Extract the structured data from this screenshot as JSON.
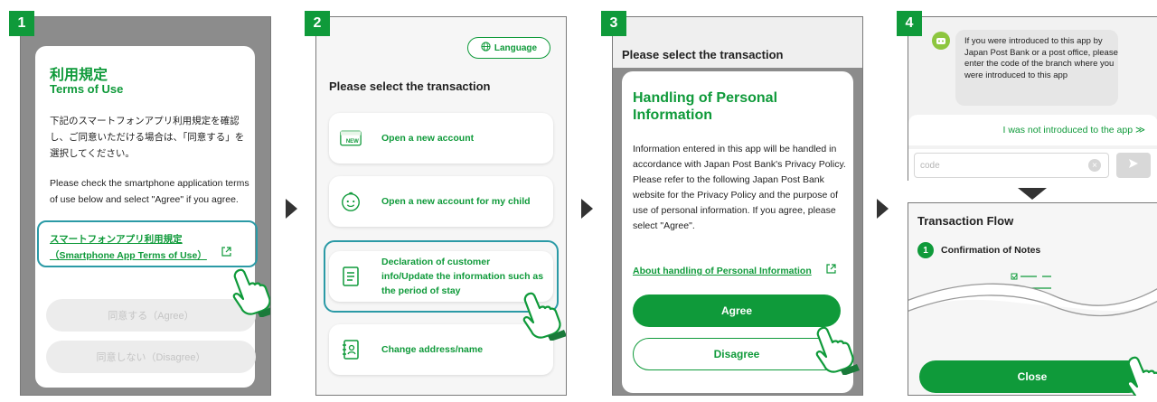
{
  "steps": [
    "1",
    "2",
    "3",
    "4"
  ],
  "panel1": {
    "title_jp": "利用規定",
    "title_en": "Terms of Use",
    "body_jp": "下記のスマートフォンアプリ利用規定を確認し、ご同意いただける場合は、「同意する」を選択してください。",
    "body_en": "Please check the smartphone application terms of use below and select \"Agree\" if you agree.",
    "link_jp": "スマートフォンアプリ利用規定",
    "link_en": "（Smartphone App Terms of Use）",
    "agree": "同意する（Agree）",
    "disagree": "同意しない（Disagree）"
  },
  "panel2": {
    "language": "Language",
    "heading": "Please select the transaction",
    "cards": [
      {
        "label": "Open a new account",
        "icon": "new-account-icon"
      },
      {
        "label": "Open a new account for my child",
        "icon": "child-face-icon"
      },
      {
        "label": "Declaration of customer info/Update the information such as the period of stay",
        "icon": "document-icon"
      },
      {
        "label": "Change address/name",
        "icon": "address-book-icon"
      }
    ]
  },
  "panel3": {
    "heading": "Please select the transaction",
    "dialog_title": "Handling of Personal Information",
    "body": "Information entered in this app will be handled in accordance with Japan Post Bank's Privacy Policy.\nPlease refer to the following Japan Post Bank website for the Privacy Policy and the purpose of use of personal information. If you agree, please select \"Agree\".",
    "link": "About handling of Personal Information",
    "agree": "Agree",
    "disagree": "Disagree"
  },
  "panel4": {
    "bot_message": "If you were introduced to this app by Japan Post Bank or a post office, please enter the code of the branch where you were introduced to this app",
    "not_introduced": "I was not introduced to the app ≫",
    "code_placeholder": "code",
    "flow_title": "Transaction Flow",
    "step_number": "1",
    "step_label": "Confirmation of Notes",
    "close": "Close"
  },
  "colors": {
    "accent": "#0f9a3a",
    "highlight": "#2b9aa6",
    "overlay": "#8c8c8c"
  }
}
